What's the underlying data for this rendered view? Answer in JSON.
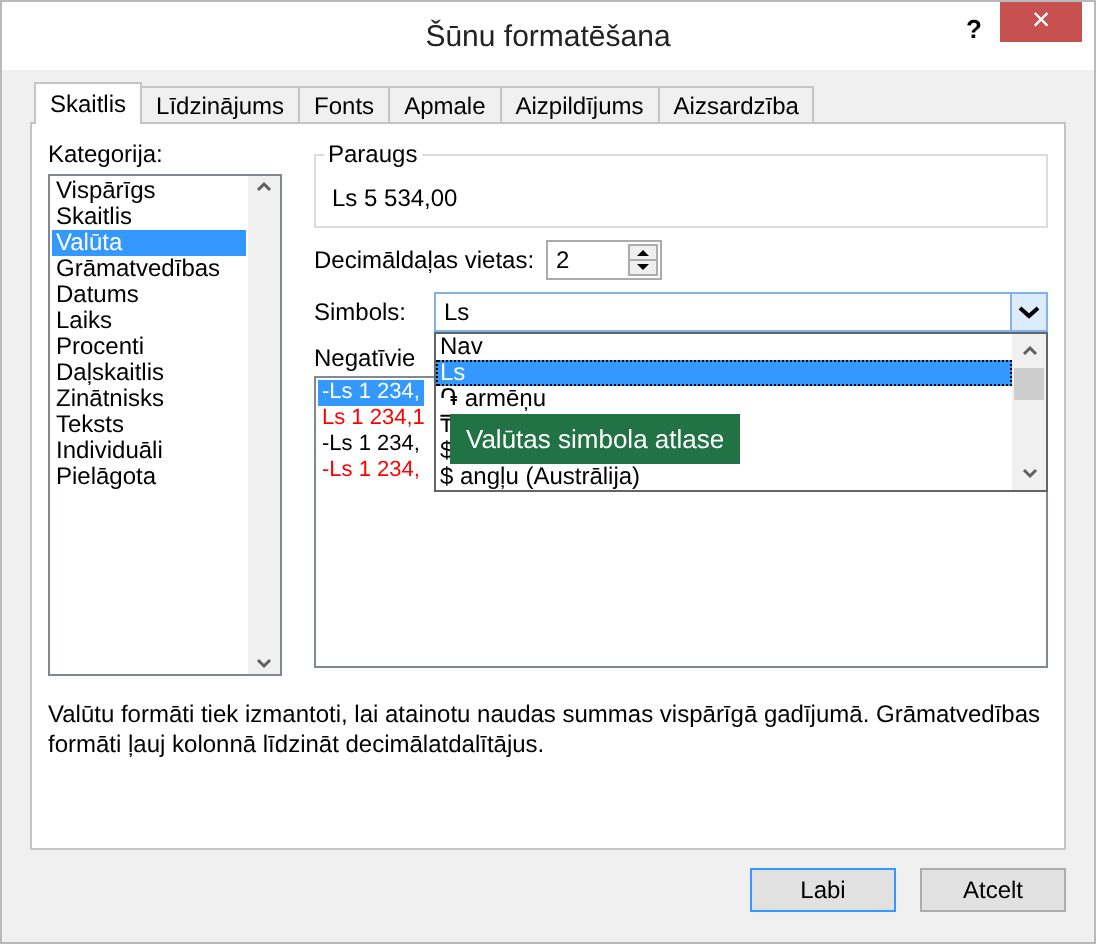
{
  "window": {
    "title": "Šūnu formatēšana",
    "help": "?",
    "close": "×"
  },
  "tabs": [
    {
      "label": "Skaitlis",
      "selected": true
    },
    {
      "label": "Līdzinājums",
      "selected": false
    },
    {
      "label": "Fonts",
      "selected": false
    },
    {
      "label": "Apmale",
      "selected": false
    },
    {
      "label": "Aizpildījums",
      "selected": false
    },
    {
      "label": "Aizsardzība",
      "selected": false
    }
  ],
  "category": {
    "label": "Kategorija:",
    "items": [
      {
        "label": "Vispārīgs",
        "selected": false
      },
      {
        "label": "Skaitlis",
        "selected": false
      },
      {
        "label": "Valūta",
        "selected": true
      },
      {
        "label": "Grāmatvedības",
        "selected": false
      },
      {
        "label": "Datums",
        "selected": false
      },
      {
        "label": "Laiks",
        "selected": false
      },
      {
        "label": "Procenti",
        "selected": false
      },
      {
        "label": "Daļskaitlis",
        "selected": false
      },
      {
        "label": "Zinātnisks",
        "selected": false
      },
      {
        "label": "Teksts",
        "selected": false
      },
      {
        "label": "Individuāli",
        "selected": false
      },
      {
        "label": "Pielāgota",
        "selected": false
      }
    ]
  },
  "sample": {
    "label": "Paraugs",
    "value": "Ls 5 534,00"
  },
  "decimal_places": {
    "label": "Decimāldaļas vietas:",
    "value": "2"
  },
  "symbol": {
    "label": "Simbols:",
    "value": "Ls",
    "expanded": true,
    "options": [
      {
        "label": "Nav",
        "selected": false
      },
      {
        "label": "Ls",
        "selected": true
      },
      {
        "label": "֏ armēņu",
        "selected": false
      },
      {
        "label": "₸",
        "selected": false
      },
      {
        "label": "$",
        "selected": false
      },
      {
        "label": "$ angļu (Austrālija)",
        "selected": false
      }
    ]
  },
  "negative": {
    "label": "Negatīvie",
    "items": [
      {
        "label": "-Ls 1 234,",
        "negative_red": false,
        "selected": true
      },
      {
        "label": "Ls 1 234,1",
        "negative_red": true,
        "selected": false
      },
      {
        "label": "-Ls 1 234,",
        "negative_red": false,
        "selected": false
      },
      {
        "label": "-Ls 1 234,",
        "negative_red": true,
        "selected": false
      }
    ]
  },
  "tooltip": "Valūtas simbola atlase",
  "description": "Valūtu formāti tiek izmantoti, lai atainotu naudas summas vispārīgā gadījumā. Grāmatvedības formāti ļauj kolonnā līdzināt decimālatdalītājus.",
  "buttons": [
    {
      "label": "Labi",
      "default": true
    },
    {
      "label": "Atcelt",
      "default": false
    }
  ]
}
